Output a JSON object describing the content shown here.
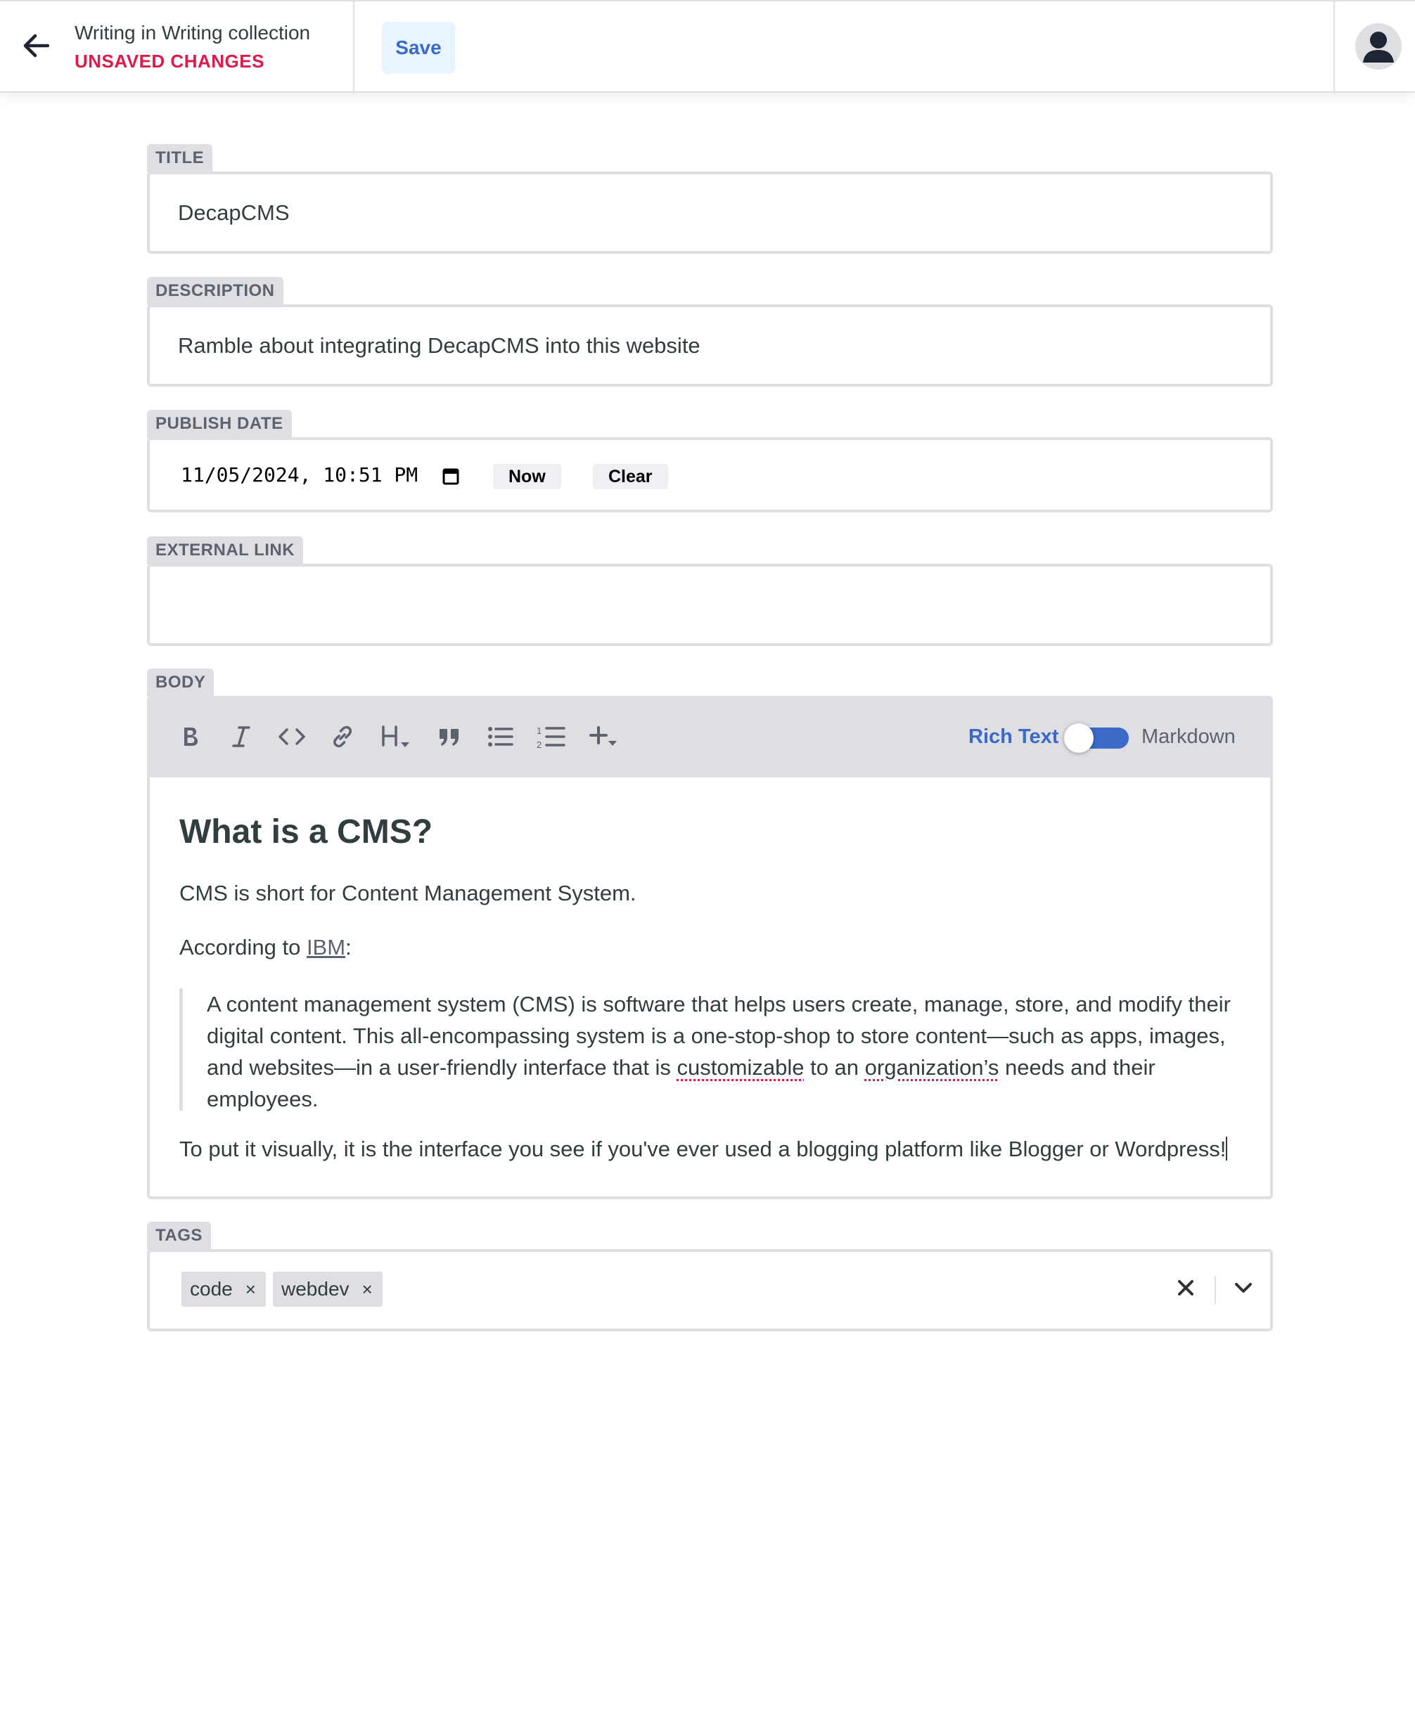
{
  "header": {
    "back_icon": "arrow-left-icon",
    "entry_title": "Writing in Writing collection",
    "status": "UNSAVED CHANGES",
    "save_label": "Save",
    "avatar_icon": "user-avatar-icon"
  },
  "fields": {
    "title": {
      "label": "TITLE",
      "value": "DecapCMS"
    },
    "description": {
      "label": "DESCRIPTION",
      "value": "Ramble about integrating DecapCMS into this website"
    },
    "publish_date": {
      "label": "PUBLISH DATE",
      "value": "11/05/2024, 10:51 PM",
      "now_label": "Now",
      "clear_label": "Clear"
    },
    "external_link": {
      "label": "EXTERNAL LINK",
      "value": ""
    },
    "body": {
      "label": "BODY",
      "toolbar": {
        "buttons": [
          "bold-icon",
          "italic-icon",
          "code-icon",
          "link-icon",
          "heading-icon",
          "quote-icon",
          "bulleted-list-icon",
          "numbered-list-icon",
          "add-component-icon"
        ],
        "mode_rich": "Rich Text",
        "mode_markdown": "Markdown"
      },
      "heading": "What is a CMS?",
      "p1": "CMS is short for Content Management System.",
      "p2_prefix": "According to ",
      "p2_link": "IBM",
      "p2_suffix": ":",
      "quote_line1": "A content management system (CMS) is software that helps users create, manage, store, and modify their",
      "quote_line2": "digital content. This all-encompassing system is a one-stop-shop to store content—such as apps, images,",
      "quote_line3_a": "and websites—in a user-friendly interface that is ",
      "quote_line3_b": "customizable",
      "quote_line3_c": " to an ",
      "quote_line3_d": "organization’s",
      "quote_line3_e": " needs and their",
      "quote_line4": "employees.",
      "p3": "To put it visually, it is the interface you see if you've ever used a blogging platform like Blogger or Wordpress!"
    },
    "tags": {
      "label": "TAGS",
      "items": [
        "code",
        "webdev"
      ],
      "remove_glyph": "×"
    }
  },
  "colors": {
    "accent": "#3a69c7",
    "danger": "#e0194a",
    "label_bg": "#dfdfe3",
    "save_bg": "#e8f5fe",
    "text": "#313d3e"
  }
}
